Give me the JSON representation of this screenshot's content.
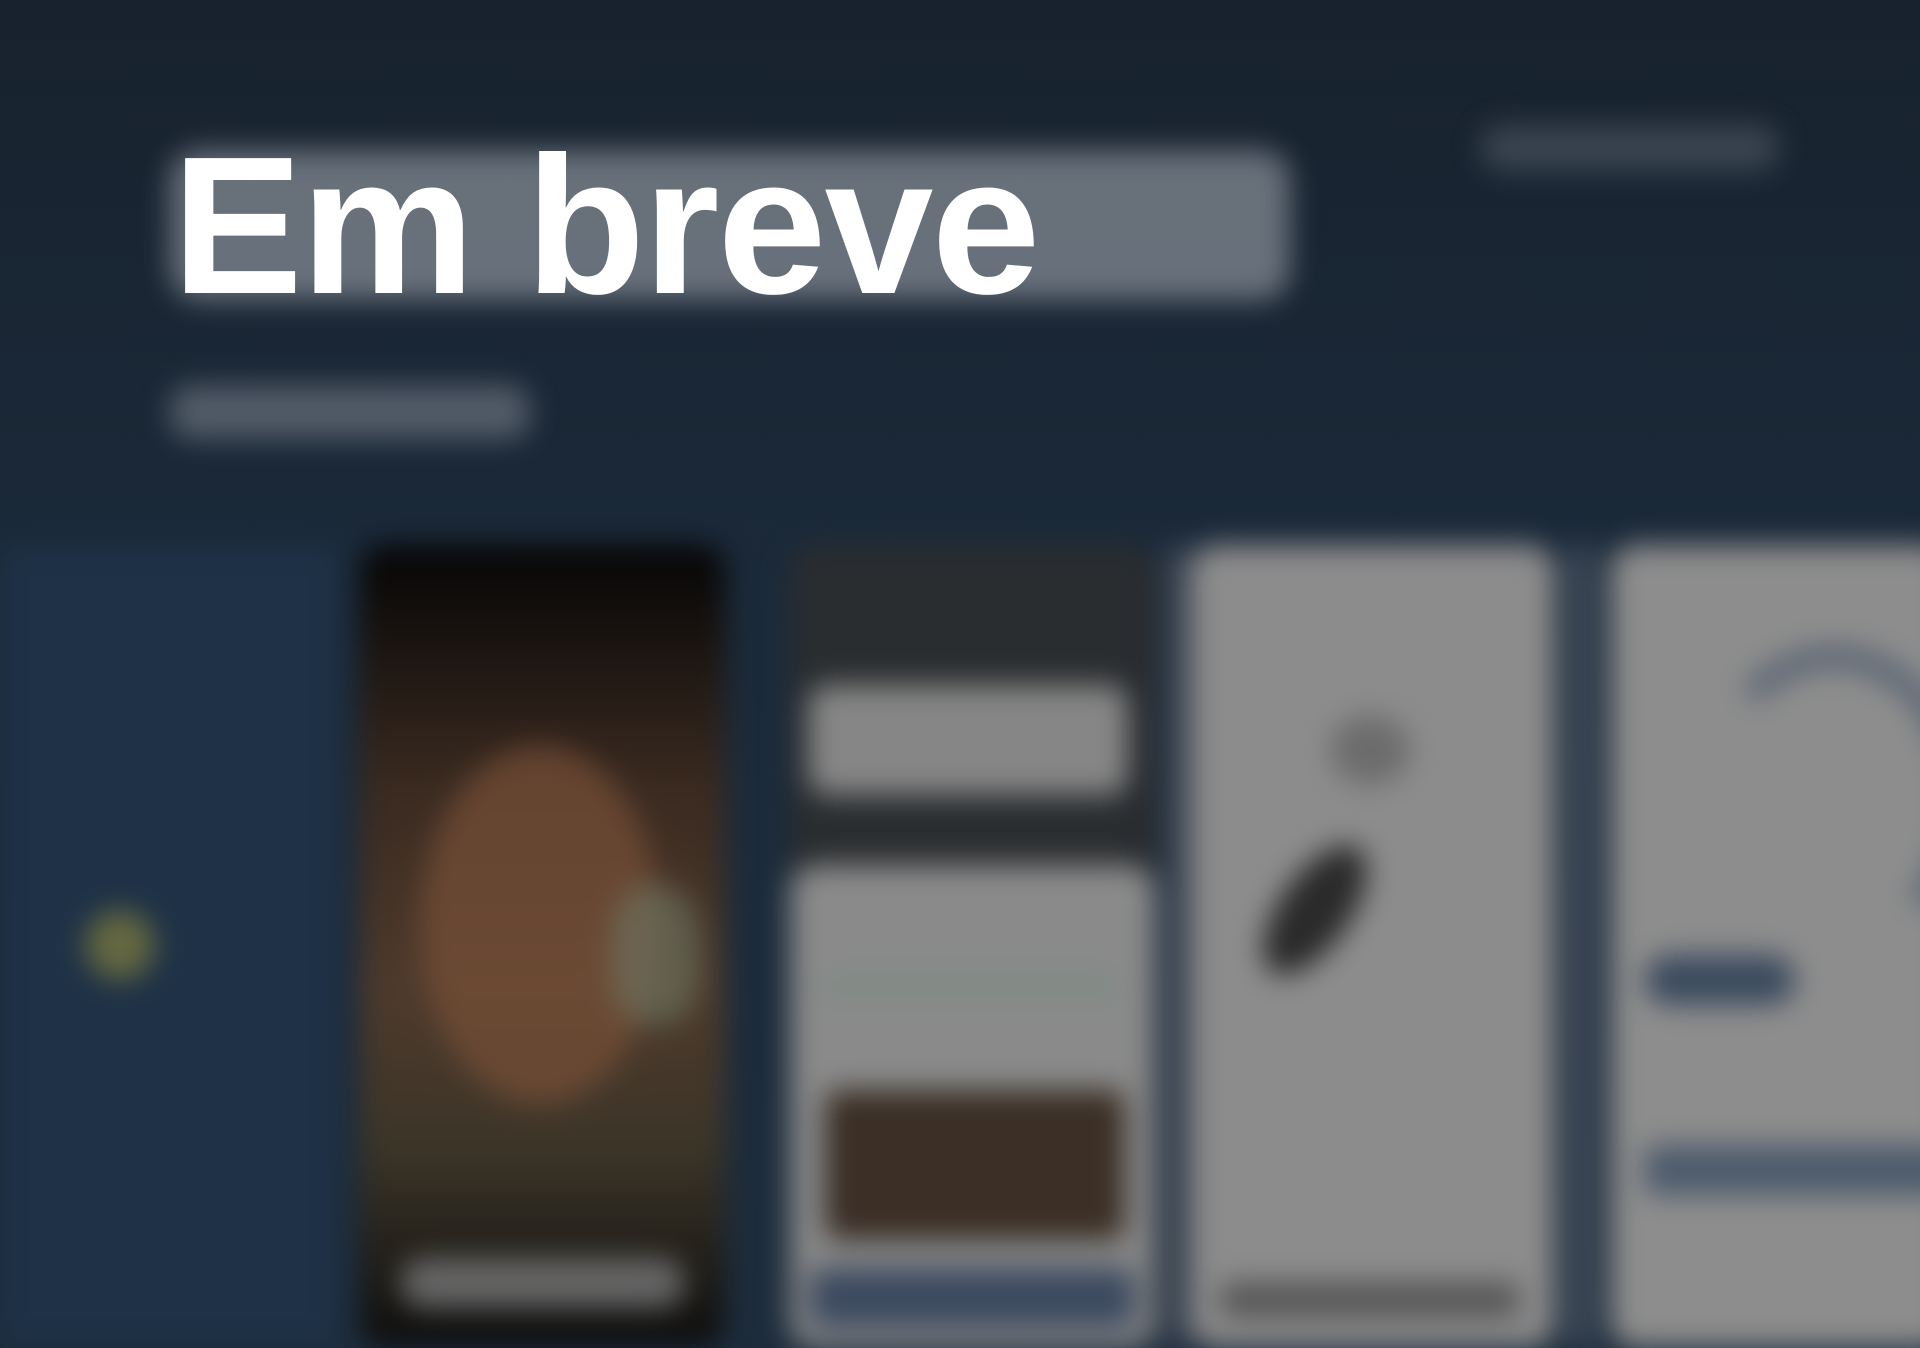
{
  "overlay": {
    "title": "Em breve"
  },
  "theme": {
    "background": "#1a2634",
    "text": "#ffffff"
  }
}
